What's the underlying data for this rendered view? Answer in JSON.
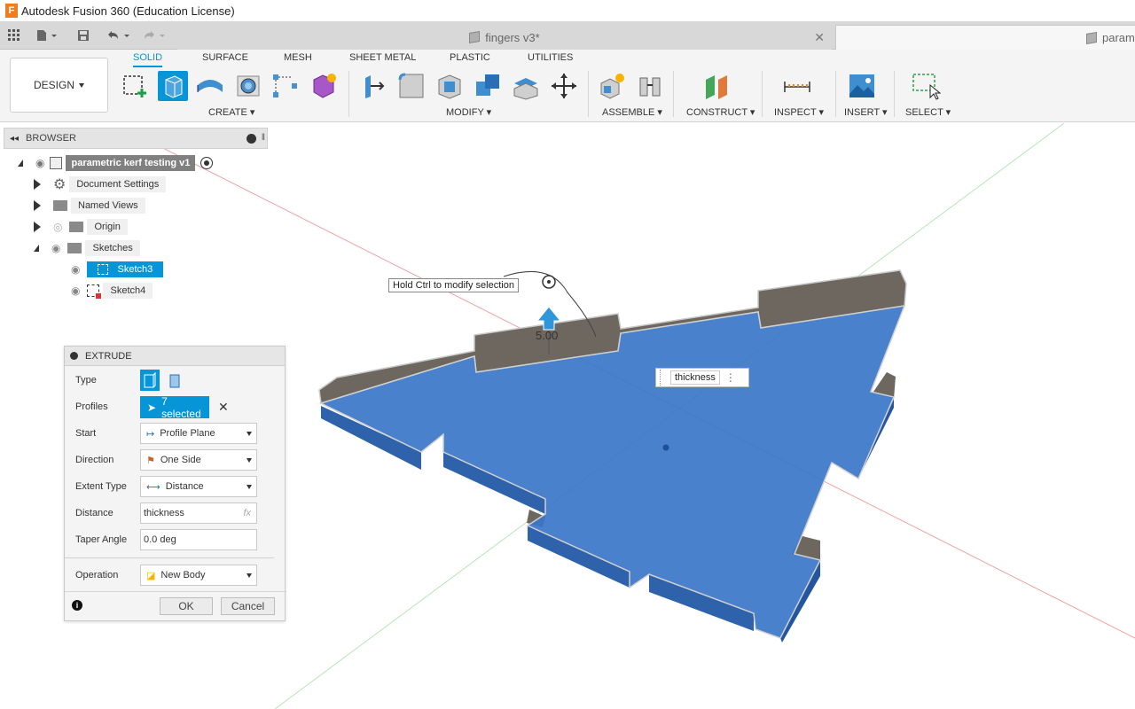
{
  "window": {
    "title": "Autodesk Fusion 360 (Education License)"
  },
  "tabs": {
    "inactive_doc": "fingers v3*",
    "active_doc": "param"
  },
  "toolbar": {
    "workspace": "DESIGN",
    "tabs": [
      "SOLID",
      "SURFACE",
      "MESH",
      "SHEET METAL",
      "PLASTIC",
      "UTILITIES"
    ],
    "groups": [
      "CREATE",
      "MODIFY",
      "ASSEMBLE",
      "CONSTRUCT",
      "INSPECT",
      "INSERT",
      "SELECT"
    ]
  },
  "browser": {
    "title": "BROWSER",
    "root": "parametric kerf testing v1",
    "items": [
      "Document Settings",
      "Named Views",
      "Origin",
      "Sketches",
      "Sketch3",
      "Sketch4"
    ]
  },
  "extrude": {
    "title": "EXTRUDE",
    "labels": {
      "type": "Type",
      "profiles": "Profiles",
      "start": "Start",
      "direction": "Direction",
      "extent_type": "Extent Type",
      "distance": "Distance",
      "taper_angle": "Taper Angle",
      "operation": "Operation"
    },
    "profiles_value": "7 selected",
    "start_value": "Profile Plane",
    "direction_value": "One Side",
    "extent_type_value": "Distance",
    "distance_value": "thickness",
    "fx": "fx",
    "taper_value": "0.0 deg",
    "operation_value": "New Body",
    "ok": "OK",
    "cancel": "Cancel"
  },
  "viewport": {
    "tooltip": "Hold Ctrl to modify selection",
    "value_chip": "thickness",
    "dim_text": "5.00"
  },
  "colors": {
    "accent": "#0696d7",
    "body": "#3a76c8",
    "edge": "#707070"
  }
}
